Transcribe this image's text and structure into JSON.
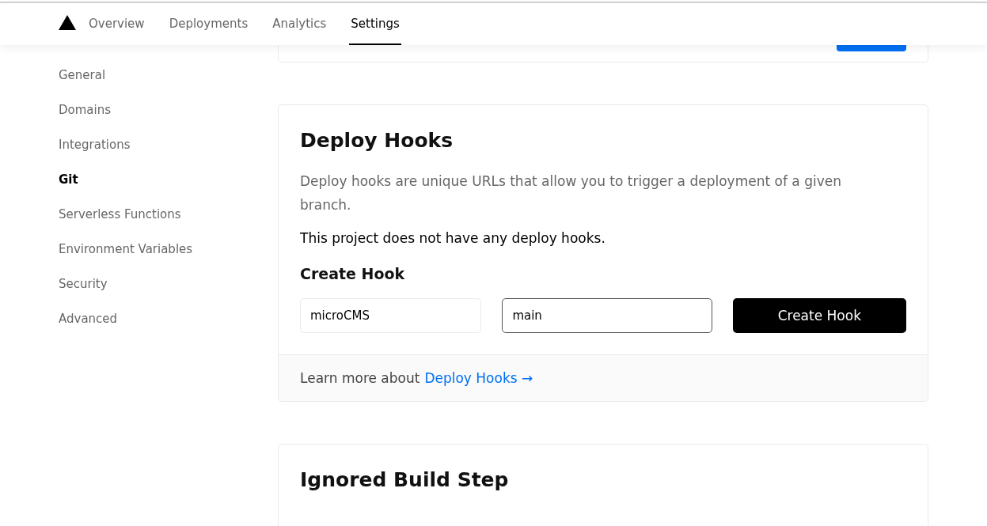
{
  "nav": {
    "tabs": [
      {
        "label": "Overview",
        "selected": false
      },
      {
        "label": "Deployments",
        "selected": false
      },
      {
        "label": "Analytics",
        "selected": false
      },
      {
        "label": "Settings",
        "selected": true
      }
    ]
  },
  "sidebar": {
    "items": [
      {
        "label": "General",
        "selected": false
      },
      {
        "label": "Domains",
        "selected": false
      },
      {
        "label": "Integrations",
        "selected": false
      },
      {
        "label": "Git",
        "selected": true
      },
      {
        "label": "Serverless Functions",
        "selected": false
      },
      {
        "label": "Environment Variables",
        "selected": false
      },
      {
        "label": "Security",
        "selected": false
      },
      {
        "label": "Advanced",
        "selected": false
      }
    ]
  },
  "deploy_hooks": {
    "title": "Deploy Hooks",
    "description": "Deploy hooks are unique URLs that allow you to trigger a deployment of a given branch.",
    "empty_message": "This project does not have any deploy hooks.",
    "create_title": "Create Hook",
    "fields": [
      {
        "value": "microCMS",
        "focused": false
      },
      {
        "value": "main",
        "focused": true
      }
    ],
    "button": "Create Hook",
    "footer_text": "Learn more about",
    "footer_link": "Deploy Hooks →"
  },
  "ignored_build_step": {
    "title": "Ignored Build Step"
  }
}
